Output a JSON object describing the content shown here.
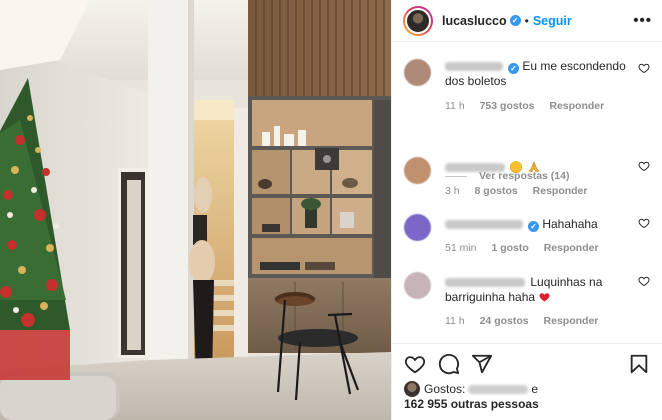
{
  "post": {
    "username": "lucaslucco",
    "follow_label": "Seguir",
    "separator": "•",
    "more_label": "•••"
  },
  "comments": [
    {
      "text": "Eu me escondendo dos boletos",
      "time": "11 h",
      "likes": "753 gostos",
      "reply": "Responder",
      "avatar_color": "#b08a78"
    },
    {
      "text": "",
      "time": "3 h",
      "likes": "8 gostos",
      "reply": "Responder",
      "avatar_color": "#c0916f"
    },
    {
      "text": "Hahahaha",
      "time": "51 min",
      "likes": "1 gosto",
      "reply": "Responder",
      "avatar_color": "#7c67c9"
    },
    {
      "text": "Luquinhas na barriguinha haha",
      "time": "11 h",
      "likes": "24 gostos",
      "reply": "Responder",
      "avatar_color": "#c7b4b8"
    }
  ],
  "view_replies": "Ver respostas (14)",
  "likes": {
    "prefix": "Gostos:",
    "conjunction": "e",
    "others": "162 955 outras pessoas"
  },
  "icons": [
    "heart-icon",
    "comment-icon",
    "share-icon",
    "bookmark-icon",
    "verified-icon",
    "more-icon"
  ],
  "colors": {
    "link_blue": "#0095f6",
    "verified_blue": "#3897f0",
    "muted_gray": "#8e8e8e",
    "text": "#262626",
    "heart_red": "#ed4956"
  }
}
